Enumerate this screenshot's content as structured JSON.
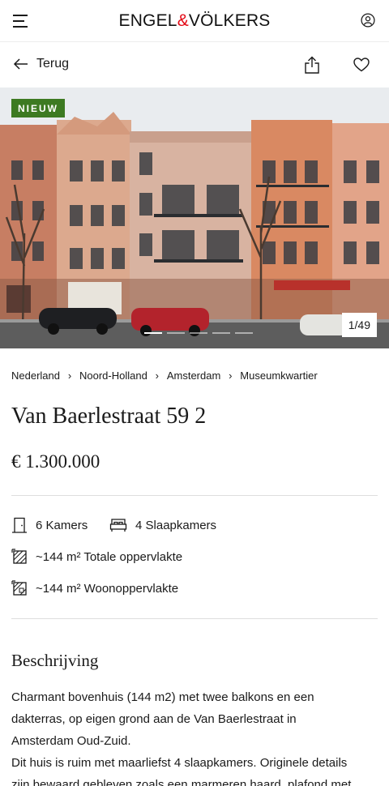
{
  "header": {
    "brand_left": "ENGEL",
    "brand_amp": "&",
    "brand_right": "VÖLKERS",
    "menu_icon": "hamburger-menu-icon",
    "user_icon": "user-account-icon"
  },
  "nav": {
    "back_label": "Terug",
    "back_icon": "arrow-left-icon",
    "share_icon": "share-icon",
    "favorite_icon": "heart-icon"
  },
  "gallery": {
    "badge": "NIEUW",
    "counter": "1/49",
    "slide_count": 5,
    "active_slide": 1,
    "badge_color": "#3d7a22"
  },
  "breadcrumb": [
    "Nederland",
    "Noord-Holland",
    "Amsterdam",
    "Museumkwartier"
  ],
  "listing": {
    "title": "Van Baerlestraat 59 2",
    "price": "€ 1.300.000"
  },
  "facts": {
    "rooms": "6 Kamers",
    "bedrooms": "4 Slaapkamers",
    "total_area": "~144 m² Totale oppervlakte",
    "living_area": "~144 m² Woonoppervlakte"
  },
  "description": {
    "heading": "Beschrijving",
    "line1": "Charmant bovenhuis (144 m2) met twee balkons en een",
    "line2": "dakterras, op eigen grond aan de Van Baerlestraat in",
    "line3": "Amsterdam Oud-Zuid.",
    "line4": "Dit huis is ruim met maarliefst 4 slaapkamers. Originele details",
    "line5": "zijn bewaard gebleven zoals een marmeren haard, plafond met"
  }
}
